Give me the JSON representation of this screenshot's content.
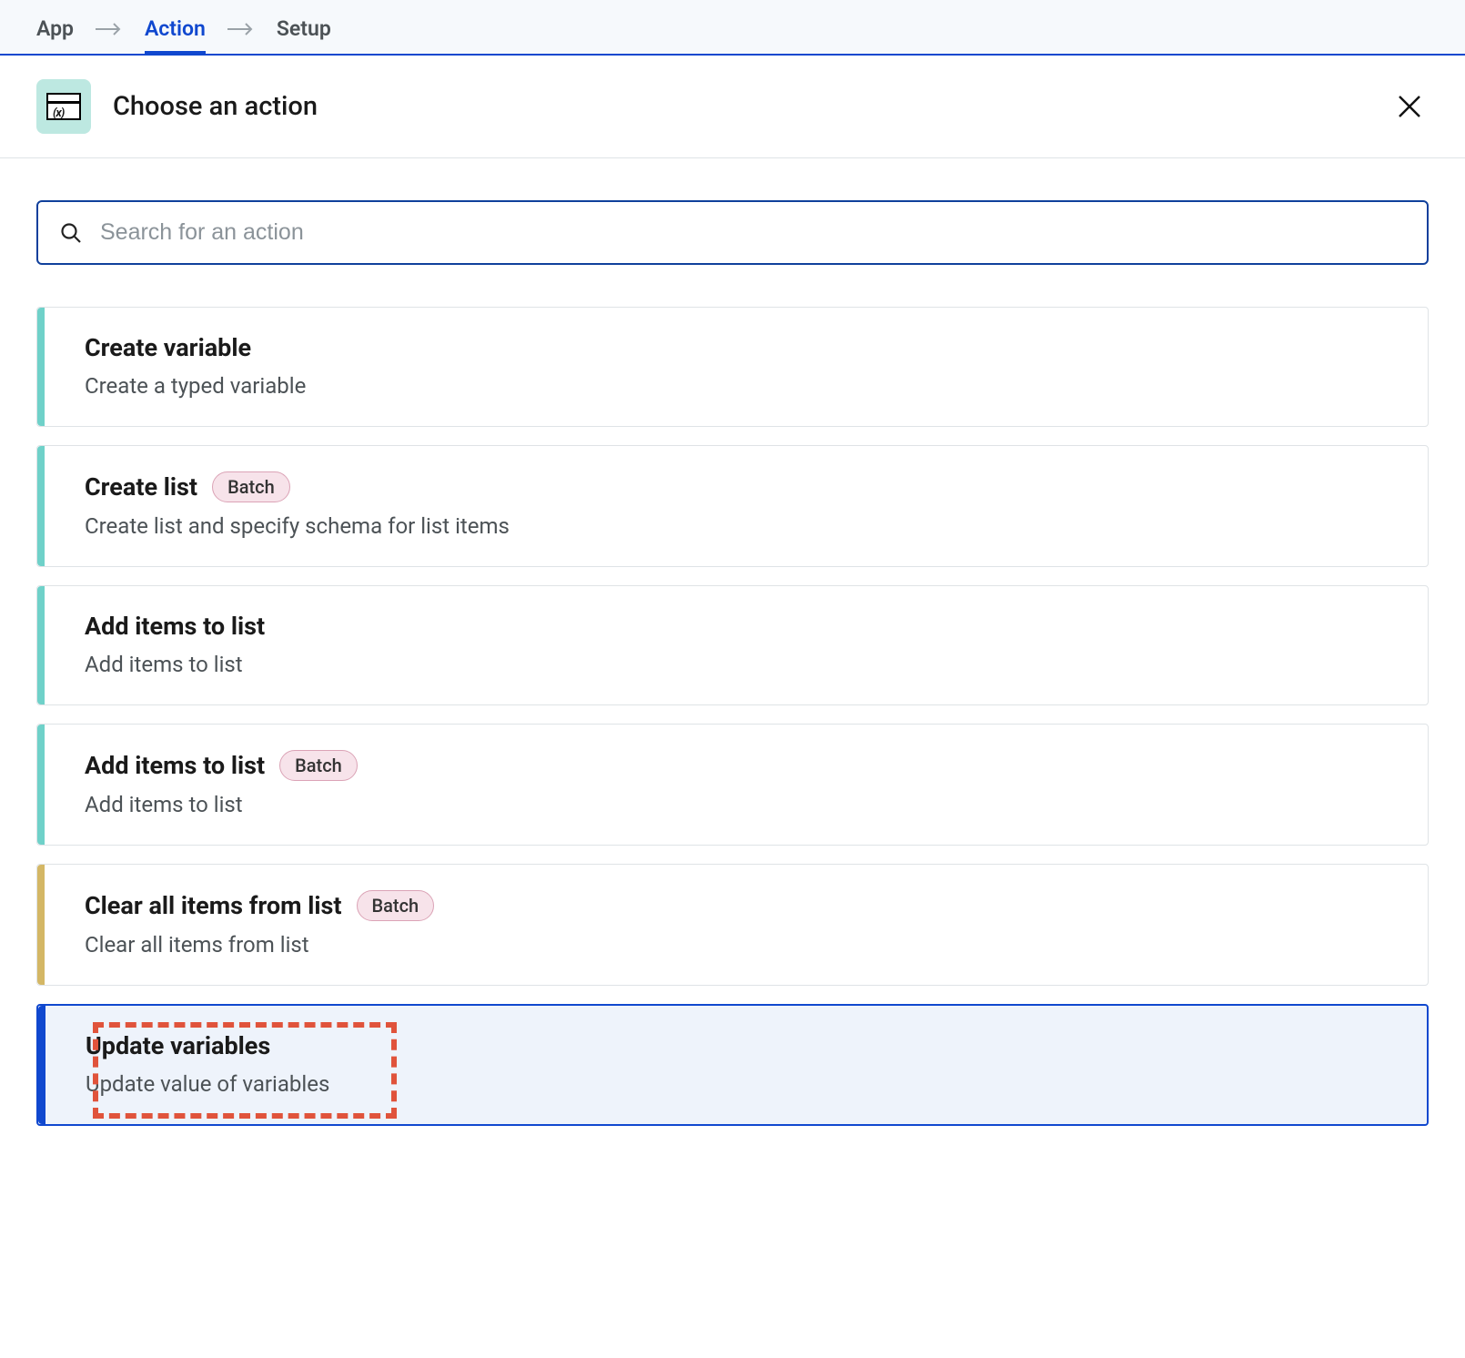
{
  "breadcrumb": {
    "items": [
      "App",
      "Action",
      "Setup"
    ],
    "activeIndex": 1
  },
  "header": {
    "title": "Choose an action"
  },
  "search": {
    "placeholder": "Search for an action",
    "value": ""
  },
  "badge": {
    "batch": "Batch"
  },
  "actions": [
    {
      "title": "Create variable",
      "desc": "Create a typed variable",
      "stripe": "teal",
      "batch": false,
      "selected": false
    },
    {
      "title": "Create list",
      "desc": "Create list and specify schema for list items",
      "stripe": "teal",
      "batch": true,
      "selected": false
    },
    {
      "title": "Add items to list",
      "desc": "Add items to list",
      "stripe": "teal",
      "batch": false,
      "selected": false
    },
    {
      "title": "Add items to list",
      "desc": "Add items to list",
      "stripe": "teal",
      "batch": true,
      "selected": false
    },
    {
      "title": "Clear all items from list",
      "desc": "Clear all items from list",
      "stripe": "ochre",
      "batch": true,
      "selected": false
    },
    {
      "title": "Update variables",
      "desc": "Update value of variables",
      "stripe": "blue",
      "batch": false,
      "selected": true,
      "highlighted": true
    }
  ]
}
